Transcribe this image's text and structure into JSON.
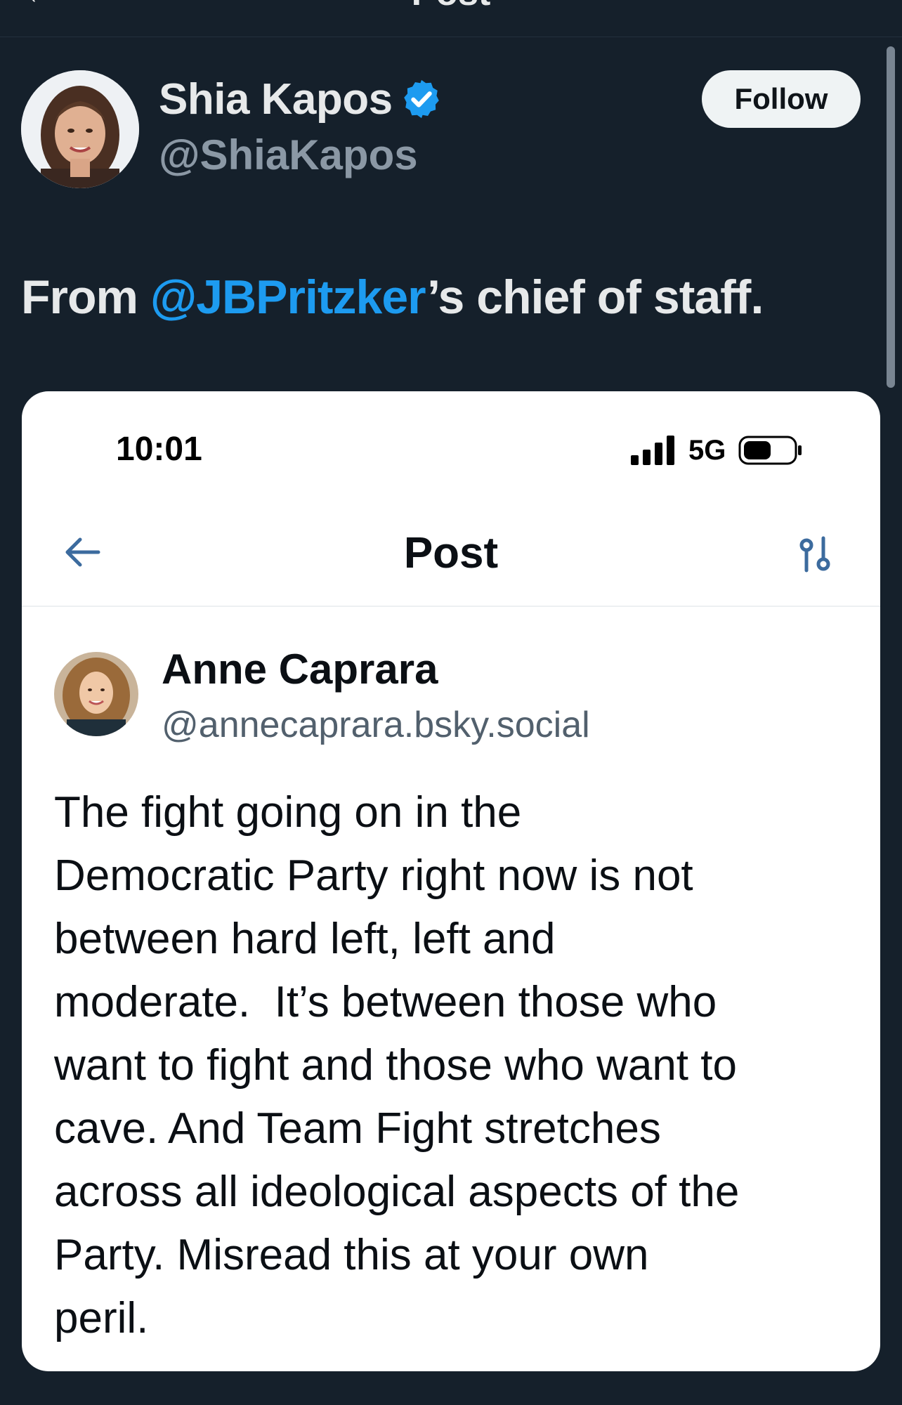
{
  "header": {
    "back_glyph": "←",
    "title": "Post"
  },
  "post": {
    "author": {
      "name": "Shia Kapos",
      "handle": "@ShiaKapos",
      "verified": true,
      "verified_color": "#1d9bf0"
    },
    "follow_label": "Follow",
    "text_before": "From ",
    "mention": "@JBPritzker",
    "text_after": "’s chief of staff.",
    "mention_color": "#1d9bf0"
  },
  "embedded": {
    "status_bar": {
      "time": "10:01",
      "network": "5G"
    },
    "nav": {
      "title": "Post",
      "back_icon": "arrow-left-icon",
      "settings_icon": "sliders-icon"
    },
    "quoted_post": {
      "author_name": "Anne Caprara",
      "author_handle": "@annecaprara.bsky.social",
      "lines": [
        "The fight going on in the",
        "Democratic Party right now is not",
        "between hard left, left and",
        "moderate.  It’s between those who",
        "want to fight and those who want to",
        "cave. And Team Fight stretches",
        "across all ideological aspects of the",
        "Party. Misread this at your own",
        "peril."
      ]
    }
  },
  "colors": {
    "background": "#15202b",
    "primary_text": "#e7e9ea",
    "secondary_text": "#8b98a5",
    "accent": "#1d9bf0",
    "card_background": "#ffffff",
    "card_link": "#3c6b9e"
  }
}
